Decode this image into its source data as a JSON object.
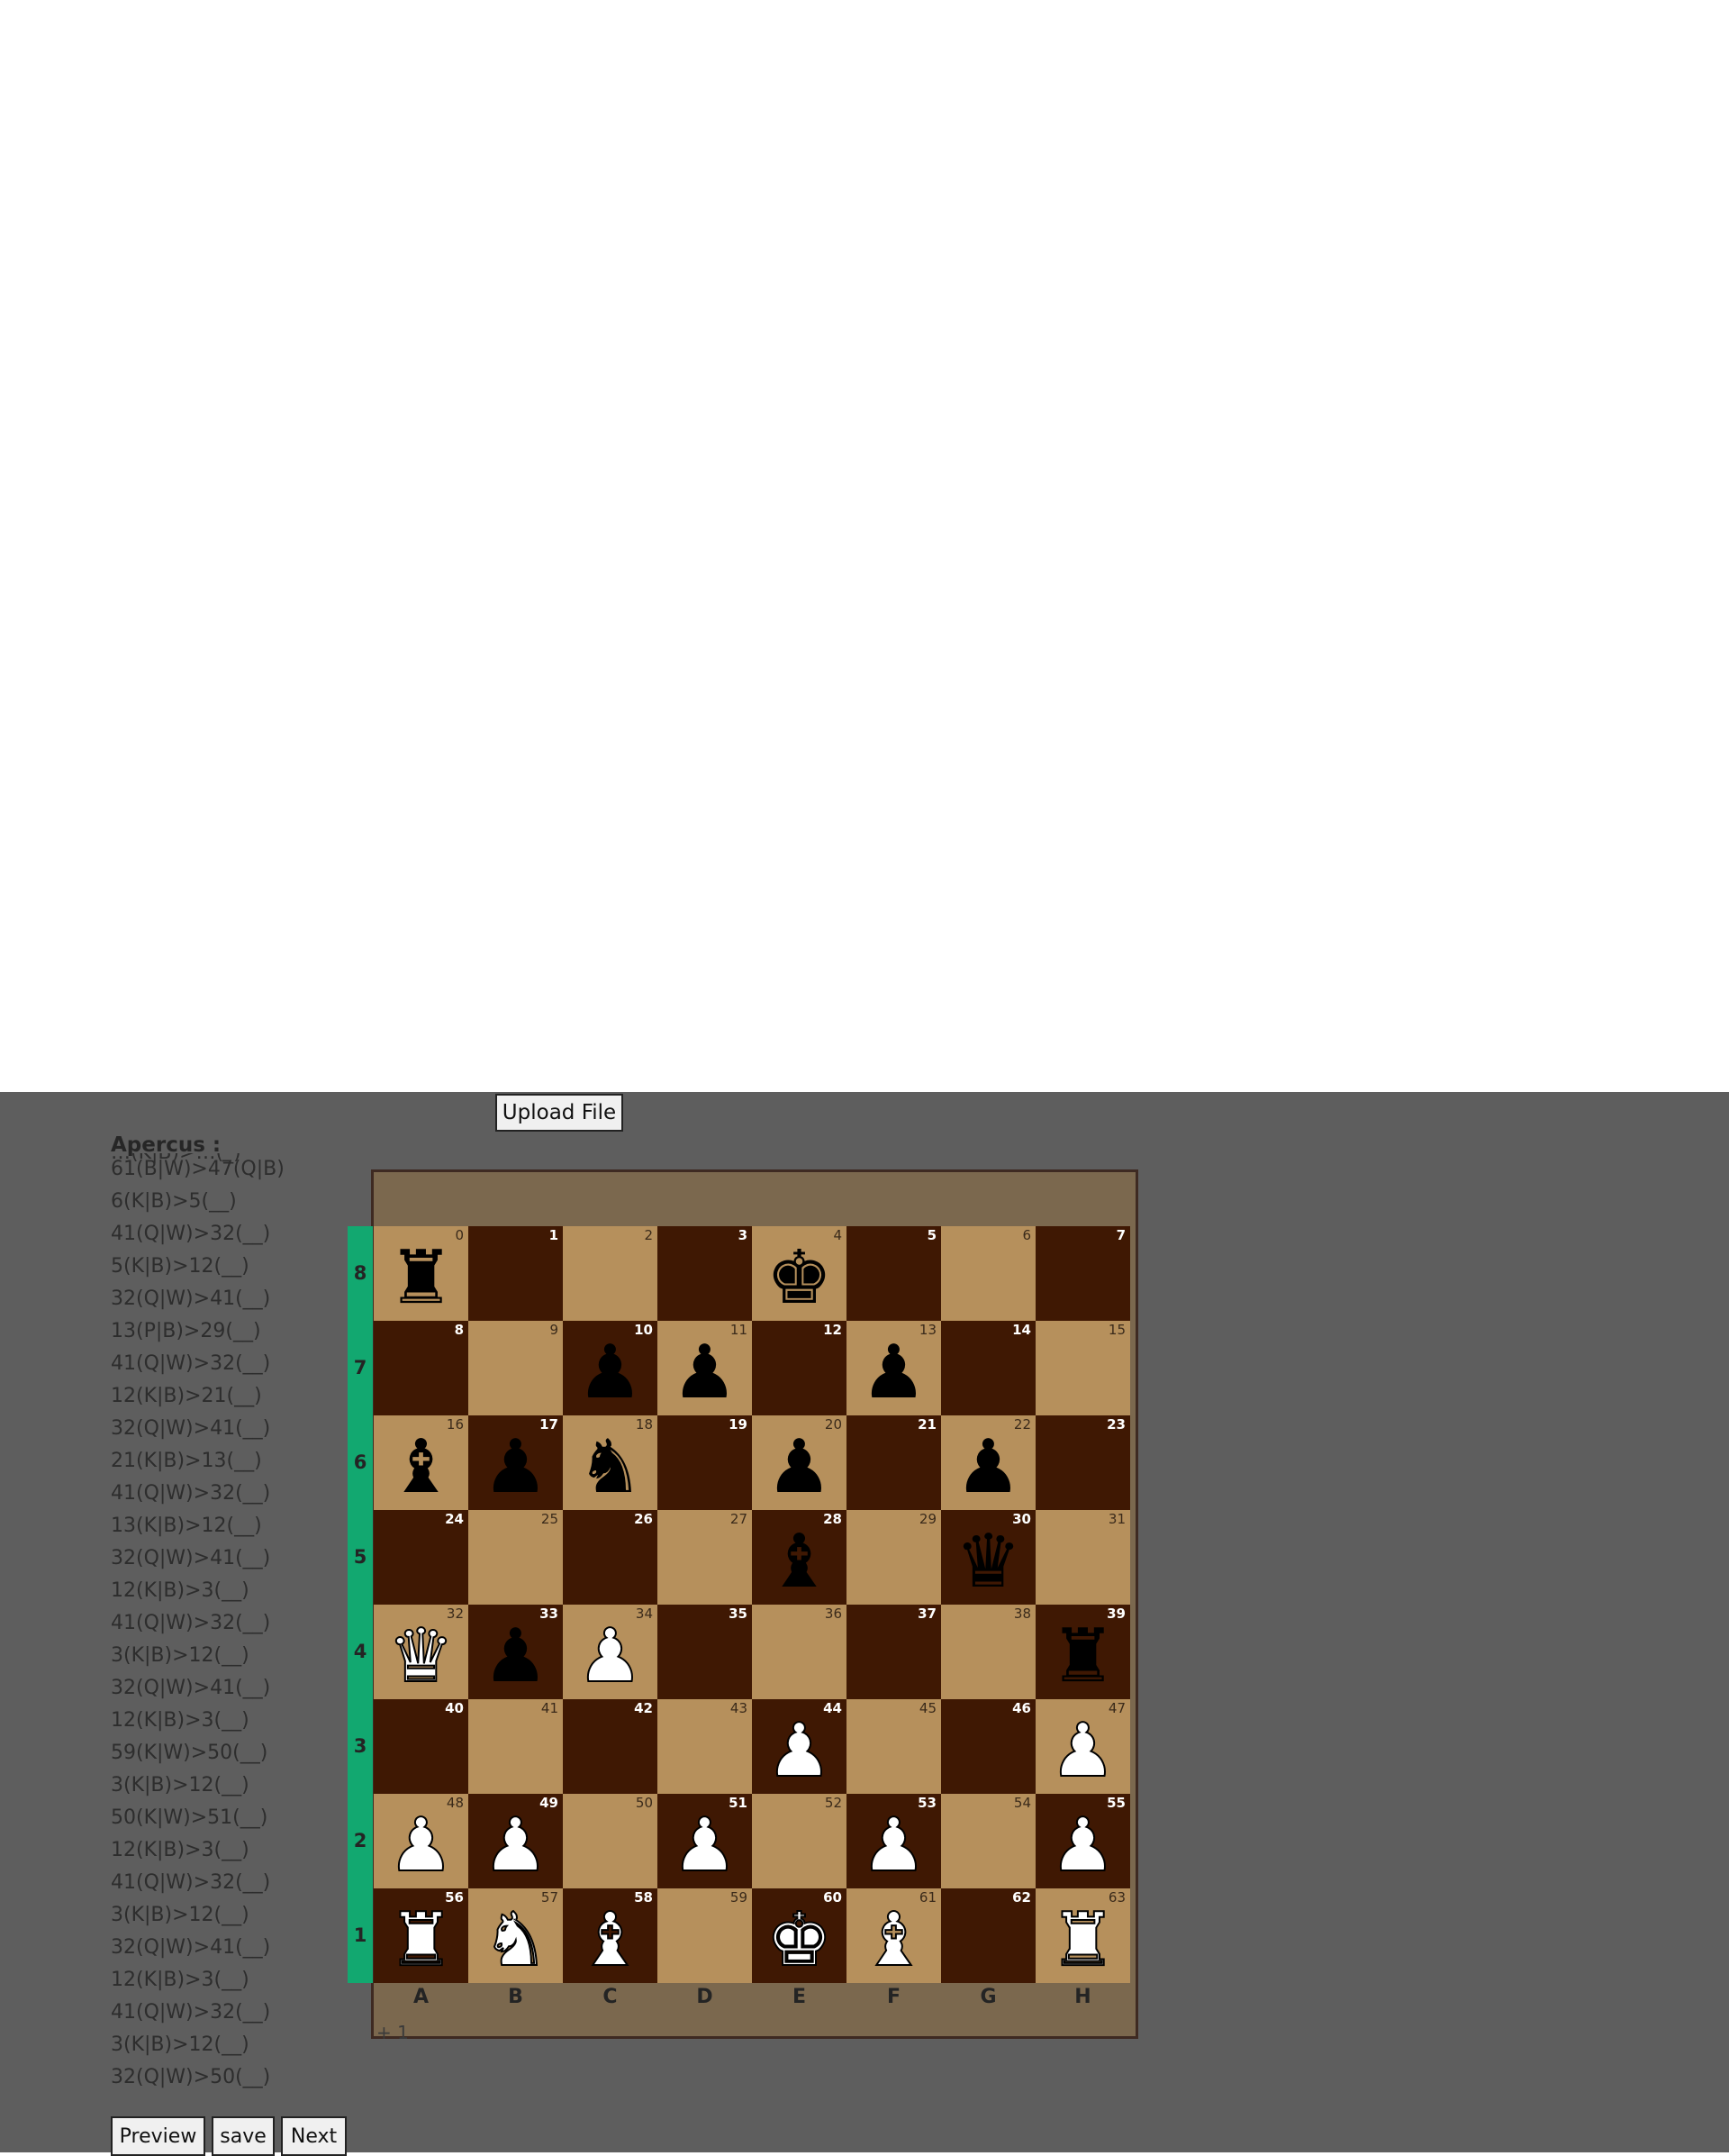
{
  "upload_button": "Upload File",
  "apercus": {
    "title": "Apercus :",
    "partial_top": "…(K|B)>…(_)",
    "moves": [
      "61(B|W)>47(Q|B)",
      "6(K|B)>5(__)",
      "41(Q|W)>32(__)",
      "5(K|B)>12(__)",
      "32(Q|W)>41(__)",
      "13(P|B)>29(__)",
      "41(Q|W)>32(__)",
      "12(K|B)>21(__)",
      "32(Q|W)>41(__)",
      "21(K|B)>13(__)",
      "41(Q|W)>32(__)",
      "13(K|B)>12(__)",
      "32(Q|W)>41(__)",
      "12(K|B)>3(__)",
      "41(Q|W)>32(__)",
      "3(K|B)>12(__)",
      "32(Q|W)>41(__)",
      "12(K|B)>3(__)",
      "59(K|W)>50(__)",
      "3(K|B)>12(__)",
      "50(K|W)>51(__)",
      "12(K|B)>3(__)",
      "41(Q|W)>32(__)",
      "3(K|B)>12(__)",
      "32(Q|W)>41(__)",
      "12(K|B)>3(__)",
      "41(Q|W)>32(__)",
      "3(K|B)>12(__)",
      "32(Q|W)>50(__)"
    ]
  },
  "buttons": {
    "preview": "Preview",
    "save": "save",
    "next": "Next"
  },
  "board": {
    "files": [
      "A",
      "B",
      "C",
      "D",
      "E",
      "F",
      "G",
      "H"
    ],
    "ranks": [
      "8",
      "7",
      "6",
      "5",
      "4",
      "3",
      "2",
      "1"
    ],
    "square_colors": {
      "light": "#b6905c",
      "dark": "#3f1803",
      "rank_bar": "#12a870",
      "frame": "#7b684e"
    },
    "pieces": {
      "0": "black-rook",
      "4": "black-king",
      "10": "black-pawn",
      "11": "black-pawn",
      "13": "black-pawn",
      "16": "black-bishop",
      "17": "black-pawn",
      "18": "black-knight",
      "20": "black-pawn",
      "22": "black-pawn",
      "28": "black-bishop",
      "30": "black-queen",
      "32": "white-queen",
      "33": "black-pawn",
      "34": "white-pawn",
      "39": "black-rook",
      "44": "white-pawn",
      "47": "white-pawn",
      "48": "white-pawn",
      "49": "white-pawn",
      "51": "white-pawn",
      "53": "white-pawn",
      "55": "white-pawn",
      "56": "white-rook",
      "57": "white-knight",
      "58": "white-bishop",
      "60": "white-king",
      "61": "white-bishop",
      "63": "white-rook"
    }
  },
  "footer_tick": "+ 1"
}
